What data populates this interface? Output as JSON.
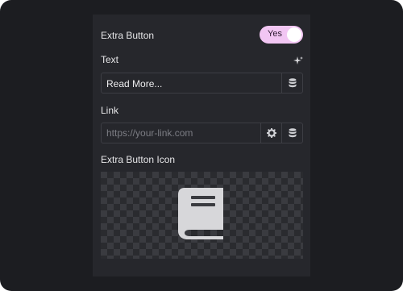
{
  "extra_button": {
    "label": "Extra Button",
    "toggle_label": "Yes",
    "enabled": true
  },
  "text_field": {
    "label": "Text",
    "value": "Read More..."
  },
  "link_field": {
    "label": "Link",
    "placeholder": "https://your-link.com"
  },
  "icon_field": {
    "label": "Extra Button Icon",
    "icon": "book-icon"
  },
  "icons": {
    "ai": "sparkle-icon",
    "dynamic": "database-icon",
    "settings": "gear-icon"
  },
  "colors": {
    "background": "#1c1d21",
    "panel": "#26272c",
    "toggle_on": "#f2c6f3",
    "field_border": "#3d3e44"
  }
}
